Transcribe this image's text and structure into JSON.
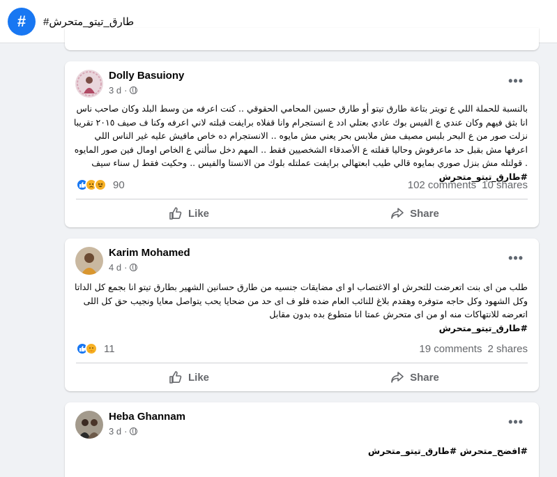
{
  "header": {
    "badge": "#",
    "title": "#طارق_تيتو_متحرش"
  },
  "posts": [
    {
      "author": "Dolly Basuiony",
      "time": "3 d",
      "more": "•••",
      "text": "بالنسبة للحملة اللي ع تويتر بتاعة طارق تيتو أو طارق حسين المحامي الحقوقي .. كنت اعرفه من وسط البلد وكان صاحب ناس انا بثق فيهم وكان عندي ع الفيس بوك عادي بعتلي ادد ع انستجرام وانا قفلاه برايفت قبلته لاني اعرفه وكنا ف صيف ٢٠١٥ تقريبا نزلت صور من ع البحر بلبس مصيف مش ملابس بحر يعني مش مايوه .. الانستجرام ده خاص مافيش عليه غير الناس اللي اعرفها مش بقبل حد ماعرفوش وحاليا قفلته ع الأصدقاء الشخصيين فقط .. المهم دخل سألني ع الخاص اومال فين صور المايوه . قولتله مش بنزل صوري بمايوه قالي طيب ابعتهالي برايفت عملتله بلوك من الانستا والفيس .. وحكيت فقط ل سناء سيف",
      "hashtags": "#طارق_تيتو_متحرش",
      "reaction_count": "90",
      "comments": "102 comments",
      "shares": "10 shares",
      "like_label": "Like",
      "share_label": "Share"
    },
    {
      "author": "Karim Mohamed",
      "time": "4 d",
      "more": "•••",
      "text": "طلب من اى بنت اتعرضت للتحرش او الاغتصاب او اى مضايقات جنسيه من طارق حسانين الشهير بطارق تيتو انا بجمع كل الداتا وكل الشهود وكل حاجه متوفره وهقدم بلاغ للنائب العام ضده فلو ف اى حد من ضحايا يحب يتواصل معايا ونجيب حق كل اللى اتعرضه للانتهاكات منه او من اى متحرش عمتا انا متطوع بده بدون مقابل",
      "hashtags": "#طارق_تيتو_متحرش",
      "reaction_count": "11",
      "comments": "19 comments",
      "shares": "2 shares",
      "like_label": "Like",
      "share_label": "Share"
    },
    {
      "author": "Heba Ghannam",
      "time": "3 d",
      "more": "•••",
      "hashtags": "#افضح_متحرش #طارق_تيتو_متحرش"
    }
  ],
  "colors": {
    "accent": "#1877f2",
    "muted": "#65676b",
    "background": "#f0f2f5"
  },
  "icons": [
    "hashtag-icon",
    "globe-icon",
    "more-icon",
    "like-reaction-icon",
    "sad-reaction-icon",
    "haha-reaction-icon",
    "care-reaction-icon",
    "thumbs-up-icon",
    "share-icon"
  ]
}
